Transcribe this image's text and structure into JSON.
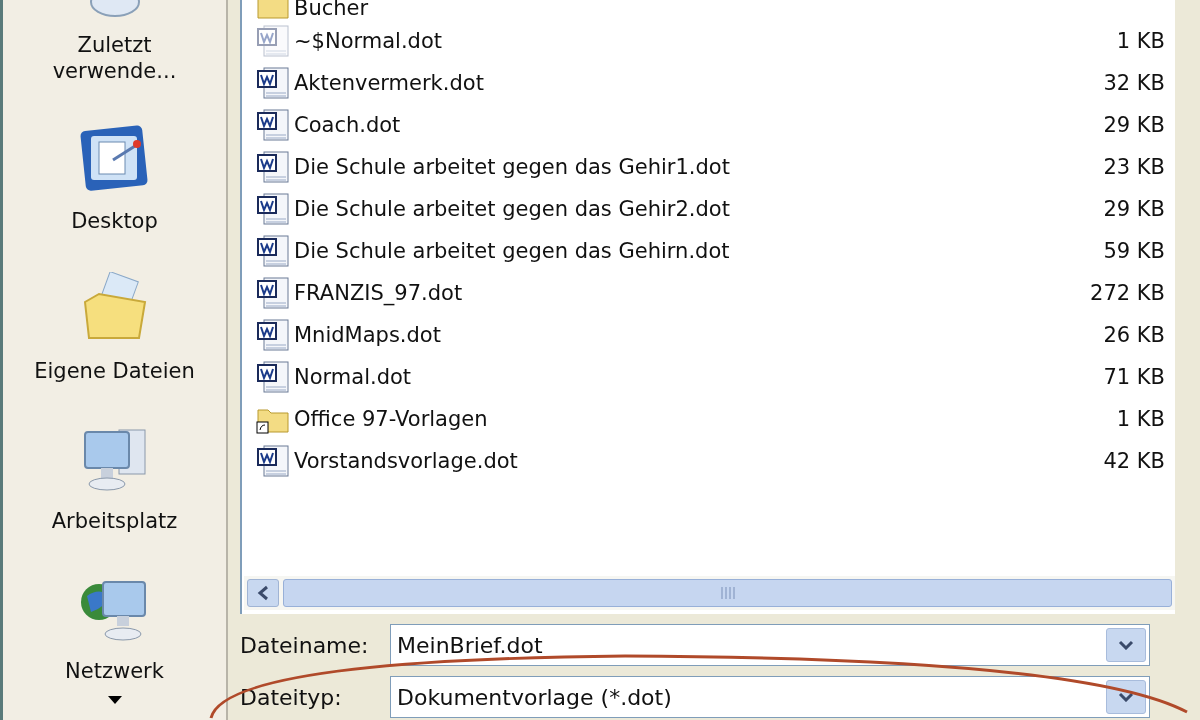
{
  "sidebar": {
    "items": [
      {
        "label": "Zuletzt verwende...",
        "kind": "recent"
      },
      {
        "label": "Desktop",
        "kind": "desktop"
      },
      {
        "label": "Eigene Dateien",
        "kind": "documents"
      },
      {
        "label": "Arbeitsplatz",
        "kind": "computer"
      },
      {
        "label": "Netzwerk",
        "kind": "network"
      }
    ]
  },
  "files": [
    {
      "name": "Bucher",
      "kind": "folder"
    },
    {
      "name": "~$Normal.dot",
      "size": "1 KB",
      "kind": "temp"
    },
    {
      "name": "Aktenvermerk.dot",
      "size": "32 KB",
      "kind": "doc"
    },
    {
      "name": "Coach.dot",
      "size": "29 KB",
      "kind": "doc"
    },
    {
      "name": "Die Schule arbeitet gegen das Gehir1.dot",
      "size": "23 KB",
      "kind": "doc"
    },
    {
      "name": "Die Schule arbeitet gegen das Gehir2.dot",
      "size": "29 KB",
      "kind": "doc"
    },
    {
      "name": "Die Schule arbeitet gegen das Gehirn.dot",
      "size": "59 KB",
      "kind": "doc"
    },
    {
      "name": "FRANZIS_97.dot",
      "size": "272 KB",
      "kind": "doc"
    },
    {
      "name": "MnidMaps.dot",
      "size": "26 KB",
      "kind": "doc"
    },
    {
      "name": "Normal.dot",
      "size": "71 KB",
      "kind": "doc"
    },
    {
      "name": "Office 97-Vorlagen",
      "size": "1 KB",
      "kind": "shortcut"
    },
    {
      "name": "Vorstandsvorlage.dot",
      "size": "42 KB",
      "kind": "doc"
    }
  ],
  "file_name": {
    "label": "Dateiname:",
    "value": "MeinBrief.dot"
  },
  "file_type": {
    "label": "Dateityp:",
    "value": "Dokumentvorlage (*.dot)"
  }
}
